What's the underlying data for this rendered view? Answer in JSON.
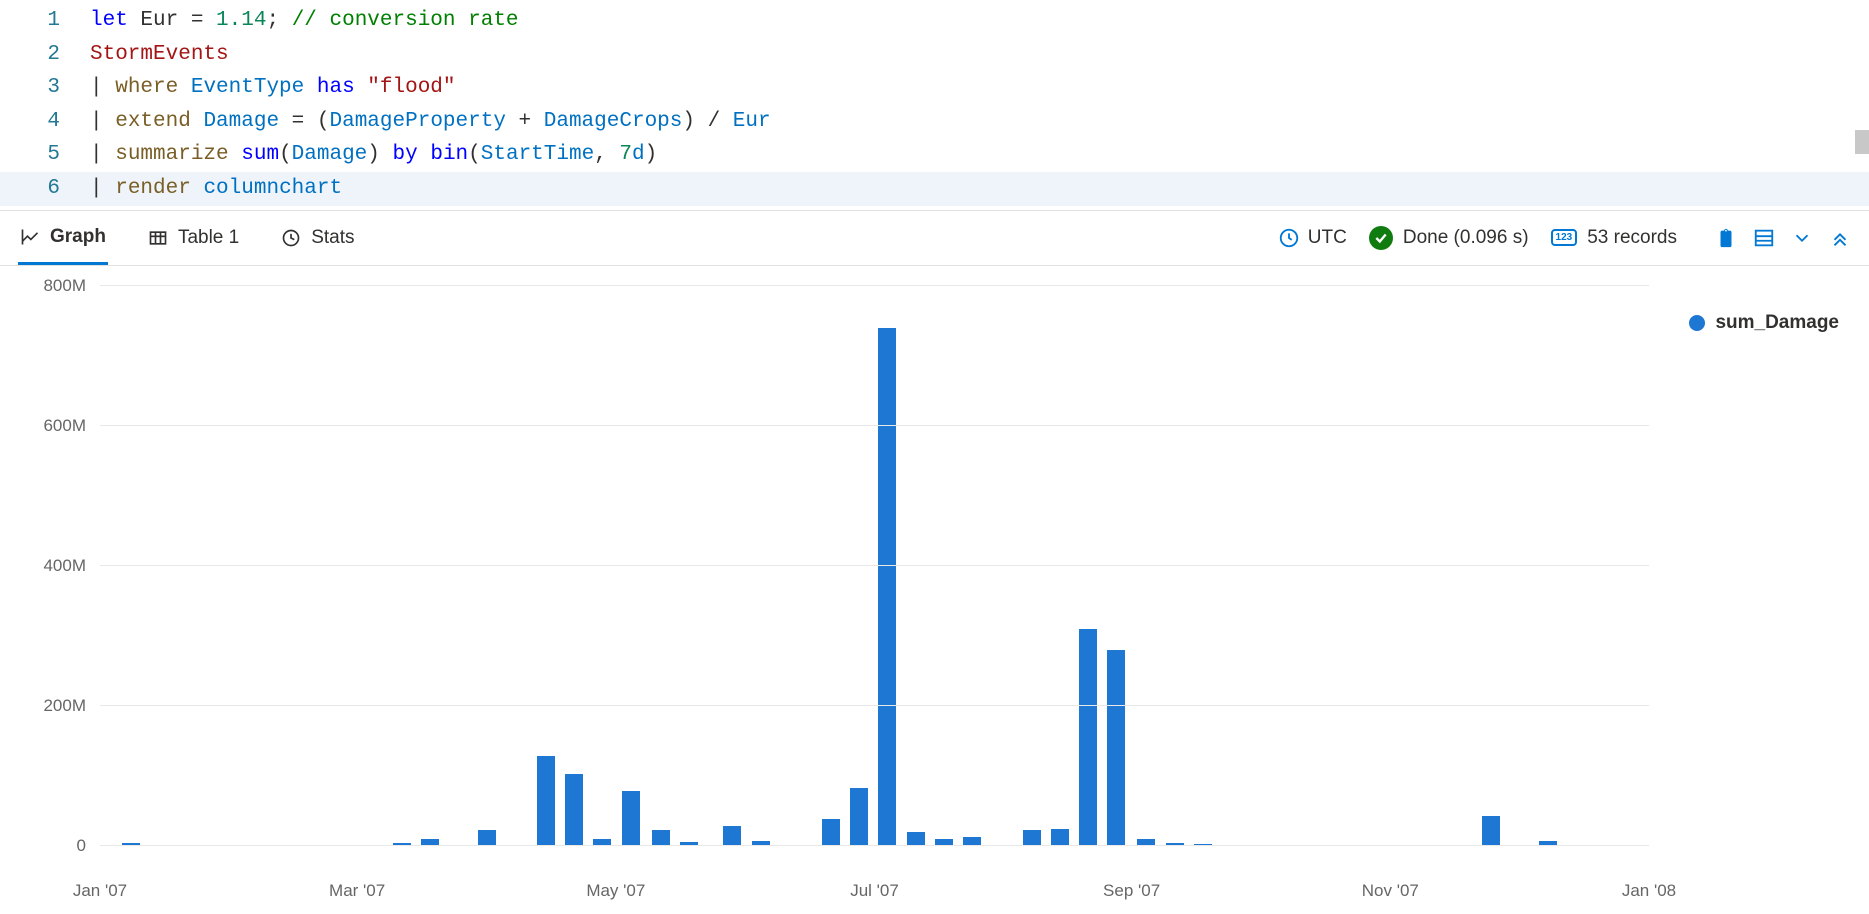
{
  "editor": {
    "lines": [
      {
        "n": "1",
        "tokens": [
          [
            "kw-let",
            "let "
          ],
          [
            "",
            "Eur = "
          ],
          [
            "num",
            "1.14"
          ],
          [
            "",
            ";"
          ],
          [
            "",
            " "
          ],
          [
            "cmt",
            "// conversion rate"
          ]
        ]
      },
      {
        "n": "2",
        "tokens": [
          [
            "tbl",
            "StormEvents"
          ]
        ]
      },
      {
        "n": "3",
        "tokens": [
          [
            "pipe",
            "| "
          ],
          [
            "opname",
            "where"
          ],
          [
            "",
            " "
          ],
          [
            "col",
            "EventType"
          ],
          [
            "",
            " "
          ],
          [
            "kw-has",
            "has"
          ],
          [
            "",
            " "
          ],
          [
            "str",
            "\"flood\""
          ]
        ]
      },
      {
        "n": "4",
        "tokens": [
          [
            "pipe",
            "| "
          ],
          [
            "opname",
            "extend"
          ],
          [
            "",
            " "
          ],
          [
            "col",
            "Damage"
          ],
          [
            "",
            " = ("
          ],
          [
            "col",
            "DamageProperty"
          ],
          [
            "",
            " + "
          ],
          [
            "col",
            "DamageCrops"
          ],
          [
            "",
            ") / "
          ],
          [
            "col",
            "Eur"
          ]
        ]
      },
      {
        "n": "5",
        "tokens": [
          [
            "pipe",
            "| "
          ],
          [
            "opname",
            "summarize"
          ],
          [
            "",
            " "
          ],
          [
            "fn",
            "sum"
          ],
          [
            "",
            "("
          ],
          [
            "col",
            "Damage"
          ],
          [
            "",
            ") "
          ],
          [
            "kw-has",
            "by"
          ],
          [
            "",
            " "
          ],
          [
            "fn",
            "bin"
          ],
          [
            "",
            "("
          ],
          [
            "col",
            "StartTime"
          ],
          [
            "",
            ", "
          ],
          [
            "num",
            "7"
          ],
          [
            "col",
            "d"
          ],
          [
            "",
            ")"
          ]
        ]
      },
      {
        "n": "6",
        "active": true,
        "tokens": [
          [
            "pipe",
            "| "
          ],
          [
            "opname",
            "render"
          ],
          [
            "",
            " "
          ],
          [
            "col",
            "columnchart"
          ]
        ]
      }
    ]
  },
  "toolbar": {
    "tabs": {
      "graph": "Graph",
      "table": "Table 1",
      "stats": "Stats"
    },
    "utc": "UTC",
    "status": "Done (0.096 s)",
    "records": "53 records"
  },
  "legend": {
    "sum_damage": "sum_Damage"
  },
  "chart_data": {
    "type": "bar",
    "ylabel": "",
    "xlabel": "",
    "ylim": [
      0,
      800000000
    ],
    "yticks": [
      "0",
      "200M",
      "400M",
      "600M",
      "800M"
    ],
    "xticks": [
      {
        "pos": 0.0,
        "label": "Jan '07"
      },
      {
        "pos": 0.166,
        "label": "Mar '07"
      },
      {
        "pos": 0.333,
        "label": "May '07"
      },
      {
        "pos": 0.5,
        "label": "Jul '07"
      },
      {
        "pos": 0.666,
        "label": "Sep '07"
      },
      {
        "pos": 0.833,
        "label": "Nov '07"
      },
      {
        "pos": 1.0,
        "label": "Jan '08"
      }
    ],
    "series": [
      {
        "name": "sum_Damage",
        "values": [
          {
            "x": 0.02,
            "y": 4000000
          },
          {
            "x": 0.195,
            "y": 3000000
          },
          {
            "x": 0.213,
            "y": 10000000
          },
          {
            "x": 0.25,
            "y": 22000000
          },
          {
            "x": 0.288,
            "y": 128000000
          },
          {
            "x": 0.306,
            "y": 102000000
          },
          {
            "x": 0.324,
            "y": 10000000
          },
          {
            "x": 0.343,
            "y": 78000000
          },
          {
            "x": 0.362,
            "y": 22000000
          },
          {
            "x": 0.38,
            "y": 5000000
          },
          {
            "x": 0.408,
            "y": 28000000
          },
          {
            "x": 0.427,
            "y": 6000000
          },
          {
            "x": 0.472,
            "y": 38000000
          },
          {
            "x": 0.49,
            "y": 82000000
          },
          {
            "x": 0.508,
            "y": 740000000
          },
          {
            "x": 0.527,
            "y": 20000000
          },
          {
            "x": 0.545,
            "y": 10000000
          },
          {
            "x": 0.563,
            "y": 12000000
          },
          {
            "x": 0.602,
            "y": 22000000
          },
          {
            "x": 0.62,
            "y": 24000000
          },
          {
            "x": 0.638,
            "y": 310000000
          },
          {
            "x": 0.656,
            "y": 280000000
          },
          {
            "x": 0.675,
            "y": 10000000
          },
          {
            "x": 0.694,
            "y": 4000000
          },
          {
            "x": 0.712,
            "y": 2000000
          },
          {
            "x": 0.898,
            "y": 42000000
          },
          {
            "x": 0.935,
            "y": 6000000
          }
        ]
      }
    ]
  }
}
